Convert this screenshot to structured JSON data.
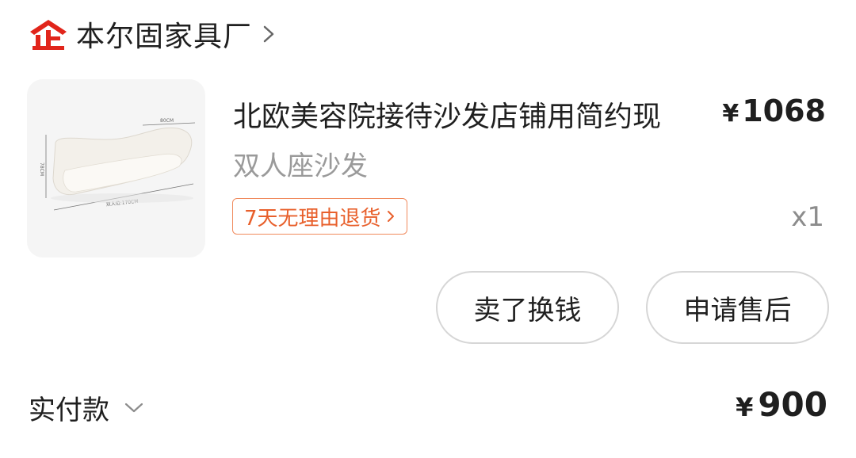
{
  "shop": {
    "logo_icon": "qi-enterprise-logo-icon",
    "name": "本尔固家具厂",
    "chevron_icon": "chevron-right-icon"
  },
  "product": {
    "title": "北欧美容院接待沙发店铺用简约现",
    "spec": "双人座沙发",
    "currency": "¥",
    "price": "1068",
    "quantity": "x1",
    "image": {
      "icon": "sofa-image",
      "dimension_top": "80CM",
      "dimension_side": "78CM",
      "dimension_bottom": "双人位:170CM"
    },
    "return_tag": {
      "label": "7天无理由退货",
      "chevron_icon": "chevron-right-icon"
    }
  },
  "actions": {
    "sell_label": "卖了换钱",
    "aftersale_label": "申请售后"
  },
  "payment": {
    "label": "实付款",
    "chevron_icon": "chevron-down-icon",
    "currency": "¥",
    "amount": "900"
  },
  "colors": {
    "brand_red": "#e1251b",
    "tag_orange": "#e8602c",
    "tag_border": "#f08a5d",
    "muted_text": "#9a9a9a",
    "button_border": "#d6d6d6"
  }
}
